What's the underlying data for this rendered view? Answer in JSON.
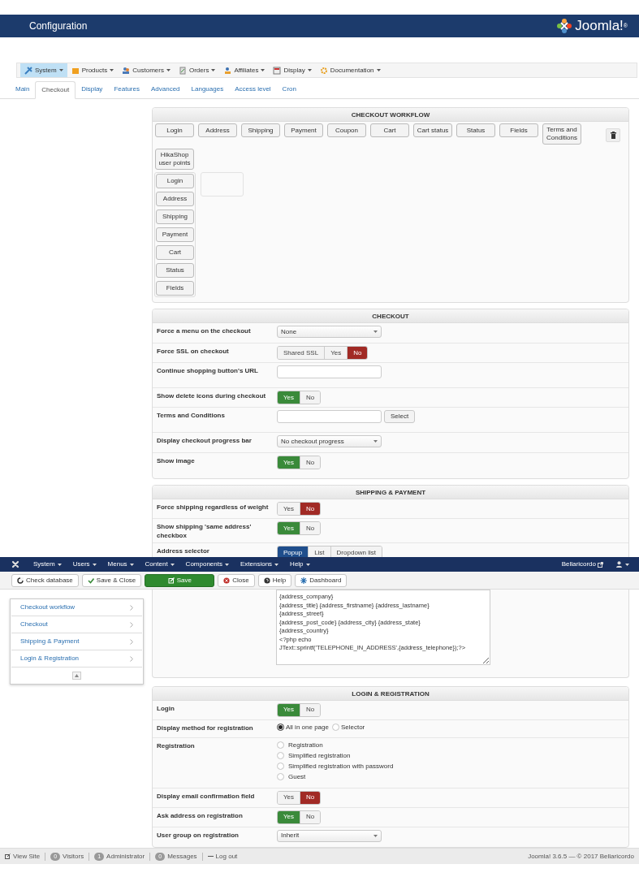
{
  "header": {
    "title": "Configuration",
    "logo_text": "Joomla!",
    "logo_mark": "®"
  },
  "component_menu": [
    {
      "label": "System",
      "selected": true
    },
    {
      "label": "Products",
      "selected": false
    },
    {
      "label": "Customers",
      "selected": false
    },
    {
      "label": "Orders",
      "selected": false
    },
    {
      "label": "Affiliates",
      "selected": false
    },
    {
      "label": "Display",
      "selected": false
    },
    {
      "label": "Documentation",
      "selected": false
    }
  ],
  "tabs": [
    {
      "label": "Main",
      "selected": false
    },
    {
      "label": "Checkout",
      "selected": true
    },
    {
      "label": "Display",
      "selected": false
    },
    {
      "label": "Features",
      "selected": false
    },
    {
      "label": "Advanced",
      "selected": false
    },
    {
      "label": "Languages",
      "selected": false
    },
    {
      "label": "Access level",
      "selected": false
    },
    {
      "label": "Cron",
      "selected": false
    }
  ],
  "workflow": {
    "title": "CHECKOUT WORKFLOW",
    "available": [
      "Login",
      "Address",
      "Shipping",
      "Payment",
      "Coupon",
      "Cart",
      "Cart status",
      "Status",
      "Fields",
      "Terms and Conditions",
      "HikaShop user points"
    ],
    "step": [
      "Login",
      "Address",
      "Shipping",
      "Payment",
      "Cart",
      "Status",
      "Fields"
    ]
  },
  "checkout": {
    "title": "CHECKOUT",
    "rows": [
      {
        "label": "Force a menu on the checkout",
        "kind": "select",
        "value": "None"
      },
      {
        "label": "Force SSL on checkout",
        "kind": "toggle",
        "options": [
          {
            "label": "Shared SSL",
            "selected": false,
            "color": "#f3f3f3"
          },
          {
            "label": "Yes",
            "selected": false,
            "color": "#f3f3f3"
          },
          {
            "label": "No",
            "selected": true,
            "color": "#a12a25"
          }
        ]
      },
      {
        "label": "Continue shopping button's URL",
        "kind": "text"
      },
      {
        "label": "Show delete icons during checkout",
        "kind": "toggle",
        "options": [
          {
            "label": "Yes",
            "selected": true,
            "color": "#3a8a3a"
          },
          {
            "label": "No",
            "selected": false,
            "color": "#f3f3f3"
          }
        ]
      },
      {
        "label": "Terms and Conditions",
        "kind": "text_button",
        "button": "Select"
      },
      {
        "label": "Display checkout progress bar",
        "kind": "select",
        "value": "No checkout progress"
      },
      {
        "label": "Show image",
        "kind": "toggle",
        "options": [
          {
            "label": "Yes",
            "selected": true,
            "color": "#3a8a3a"
          },
          {
            "label": "No",
            "selected": false,
            "color": "#f3f3f3"
          }
        ]
      }
    ]
  },
  "shipping_payment": {
    "title": "SHIPPING & PAYMENT",
    "rows": [
      {
        "label": "Force shipping regardless of weight",
        "kind": "toggle",
        "options": [
          {
            "label": "Yes",
            "selected": false,
            "color": "#f3f3f3"
          },
          {
            "label": "No",
            "selected": true,
            "color": "#a12a25"
          }
        ]
      },
      {
        "label": "Show shipping 'same address' checkbox",
        "kind": "toggle",
        "options": [
          {
            "label": "Yes",
            "selected": true,
            "color": "#3a8a3a"
          },
          {
            "label": "No",
            "selected": false,
            "color": "#f3f3f3"
          }
        ]
      },
      {
        "label": "Address selector",
        "kind": "toggle",
        "options": [
          {
            "label": "Popup",
            "selected": true,
            "color": "#1f4e8c"
          },
          {
            "label": "List",
            "selected": false,
            "color": "#f3f3f3"
          },
          {
            "label": "Dropdown list",
            "selected": false,
            "color": "#f3f3f3"
          }
        ]
      }
    ]
  },
  "admin_menu": {
    "items": [
      "System",
      "Users",
      "Menus",
      "Content",
      "Components",
      "Extensions",
      "Help"
    ],
    "site": "Bellaricordo"
  },
  "toolbar": [
    {
      "label": "Check database",
      "kind": "check"
    },
    {
      "label": "Save & Close",
      "kind": "save_close"
    },
    {
      "label": "Save",
      "kind": "save"
    },
    {
      "label": "Close",
      "kind": "close"
    },
    {
      "label": "Help",
      "kind": "help"
    },
    {
      "label": "Dashboard",
      "kind": "dashboard"
    }
  ],
  "sidebar": [
    {
      "label": "Checkout workflow"
    },
    {
      "label": "Checkout"
    },
    {
      "label": "Shipping & Payment"
    },
    {
      "label": "Login & Registration"
    }
  ],
  "address_format": "{address_company}\n{address_title} {address_firstname} {address_lastname}\n{address_street}\n{address_post_code} {address_city} {address_state}\n{address_country}\n<?php echo\nJText::sprintf('TELEPHONE_IN_ADDRESS',{address_telephone});?>",
  "login_registration": {
    "title": "LOGIN & REGISTRATION",
    "rows": [
      {
        "label": "Login",
        "kind": "toggle",
        "options": [
          {
            "label": "Yes",
            "selected": true,
            "color": "#3a8a3a"
          },
          {
            "label": "No",
            "selected": false,
            "color": "#f3f3f3"
          }
        ]
      },
      {
        "label": "Display method for registration",
        "kind": "radio_inline",
        "options": [
          {
            "label": "All in one page",
            "selected": true
          },
          {
            "label": "Selector",
            "selected": false
          }
        ]
      },
      {
        "label": "Registration",
        "kind": "radio_list",
        "options": [
          {
            "label": "Registration",
            "selected": false
          },
          {
            "label": "Simplified registration",
            "selected": false
          },
          {
            "label": "Simplified registration with password",
            "selected": false
          },
          {
            "label": "Guest",
            "selected": false
          }
        ]
      },
      {
        "label": "Display email confirmation field",
        "kind": "toggle",
        "options": [
          {
            "label": "Yes",
            "selected": false,
            "color": "#f3f3f3"
          },
          {
            "label": "No",
            "selected": true,
            "color": "#a12a25"
          }
        ]
      },
      {
        "label": "Ask address on registration",
        "kind": "toggle",
        "options": [
          {
            "label": "Yes",
            "selected": true,
            "color": "#3a8a3a"
          },
          {
            "label": "No",
            "selected": false,
            "color": "#f3f3f3"
          }
        ]
      },
      {
        "label": "User group on registration",
        "kind": "select",
        "value": "Inherit"
      }
    ]
  },
  "status_bar": {
    "left": [
      {
        "kind": "link",
        "label": "View Site"
      },
      {
        "kind": "count",
        "count": "0",
        "label": "Visitors"
      },
      {
        "kind": "count",
        "count": "1",
        "label": "Administrator"
      },
      {
        "kind": "count",
        "count": "0",
        "label": "Messages"
      },
      {
        "kind": "logout",
        "label": "Log out"
      }
    ],
    "right": "Joomla! 3.6.5 — © 2017 Bellaricordo"
  }
}
